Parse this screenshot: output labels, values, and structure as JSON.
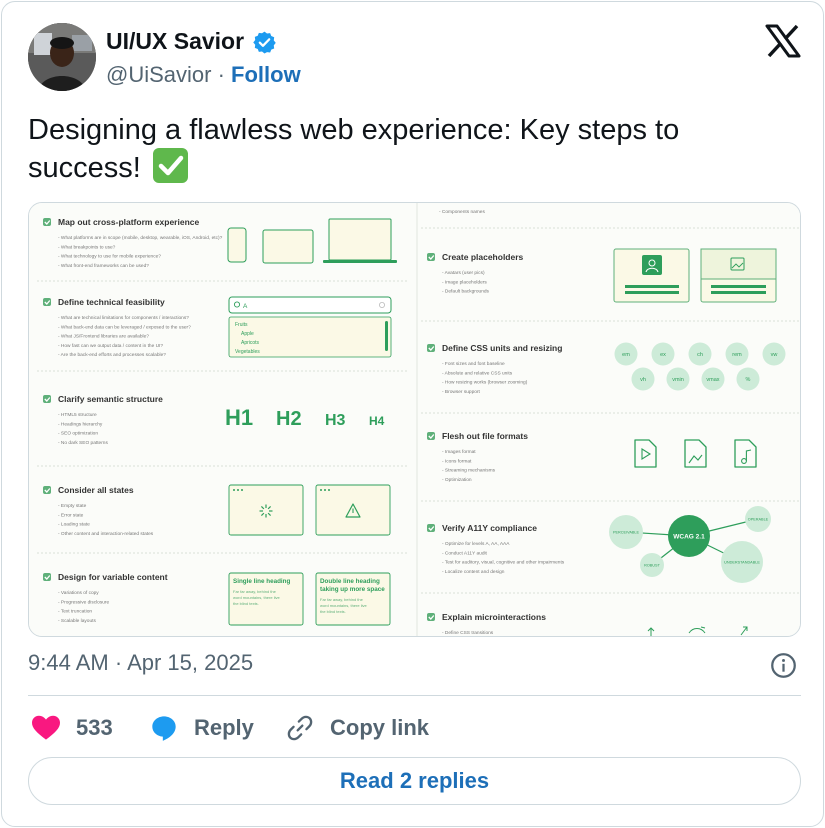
{
  "author": {
    "name": "UI/UX Savior",
    "handle": "@UiSavior",
    "separator": "·",
    "follow_label": "Follow"
  },
  "tweet": {
    "text": "Designing a flawless web experience: Key steps to success!",
    "emoji": "white-heavy-check-mark"
  },
  "media": {
    "left_sections": [
      {
        "title": "Map out cross-platform experience",
        "items": [
          "What platforms are in scope (mobile, desktop, wearable, iOS, Android, etc)?",
          "What breakpoints to use?",
          "What technology to use for mobile experience?",
          "What front-end frameworks can be used?"
        ]
      },
      {
        "title": "Define technical feasibility",
        "items": [
          "What are technical limitations for components / interactions?",
          "What back-end data can be leveraged / exposed to the user?",
          "What JS/Frontend libraries are available?",
          "How fast can we output data / content in the UI?",
          "Are the back-end efforts and processes scalable?"
        ]
      },
      {
        "title": "Clarify semantic structure",
        "items": [
          "HTML5 structure",
          "Headings hierarchy",
          "SEO optimization",
          "No dark SEO patterns"
        ]
      },
      {
        "title": "Consider all states",
        "items": [
          "Empty state",
          "Error state",
          "Loading state",
          "Other content and interaction-related states"
        ]
      },
      {
        "title": "Design for variable content",
        "items": [
          "Variations of copy",
          "Progressive disclosure",
          "Text truncation",
          "Scalable layouts"
        ]
      }
    ],
    "right_sections": [
      {
        "title": "Create placeholders",
        "items": [
          "Avatars (user pics)",
          "Image placeholders",
          "Default backgrounds"
        ]
      },
      {
        "title": "Define CSS units and resizing",
        "items": [
          "Font sizes and font baseline",
          "Absolute and relative CSS units",
          "How resizing works (browser zooming)",
          "Browser support"
        ]
      },
      {
        "title": "Flesh out file formats",
        "items": [
          "Images format",
          "Icons format",
          "Streaming mechanisms",
          "Optimization"
        ]
      },
      {
        "title": "Verify A11Y compliance",
        "items": [
          "Optimize for levels A, AA, AAA",
          "Conduct A11Y audit",
          "Test for auditory, visual, cognitive and other impairments",
          "Localize content and design"
        ]
      },
      {
        "title": "Explain microinteractions",
        "items": [
          "Define CSS transitions"
        ]
      }
    ],
    "right_top_item": "Components names",
    "search_value": "A",
    "dropdown_options": [
      "Fruits",
      "Apple",
      "Apricots",
      "Vegetables"
    ],
    "headings": [
      "H1",
      "H2",
      "H3",
      "H4"
    ],
    "variable_cards": [
      {
        "title": "Single line heading",
        "body": "Far far away, behind the word mountains, there live the blind texts."
      },
      {
        "title": "Double line heading taking up more space",
        "body": "Far far away, behind the word mountains, there live the blind texts."
      }
    ],
    "css_units_row1": [
      "em",
      "ex",
      "ch",
      "rem",
      "vw"
    ],
    "css_units_row2": [
      "vh",
      "vmin",
      "vmax",
      "%"
    ],
    "a11y_center": "WCAG 2.1",
    "a11y_nodes": [
      "PERCEIVABLE",
      "OPERABLE",
      "ROBUST",
      "UNDERSTANDABLE"
    ]
  },
  "timestamp": {
    "time": "9:44 AM",
    "separator": "·",
    "date": "Apr 15, 2025"
  },
  "actions": {
    "like_count": "533",
    "reply_label": "Reply",
    "copy_label": "Copy link"
  },
  "read_replies_label": "Read 2 replies",
  "colors": {
    "accent_blue": "#1d6fb8",
    "like_pink": "#f91880",
    "infographic_green": "#2e9e5b",
    "infographic_cream": "#fbf9e6"
  }
}
